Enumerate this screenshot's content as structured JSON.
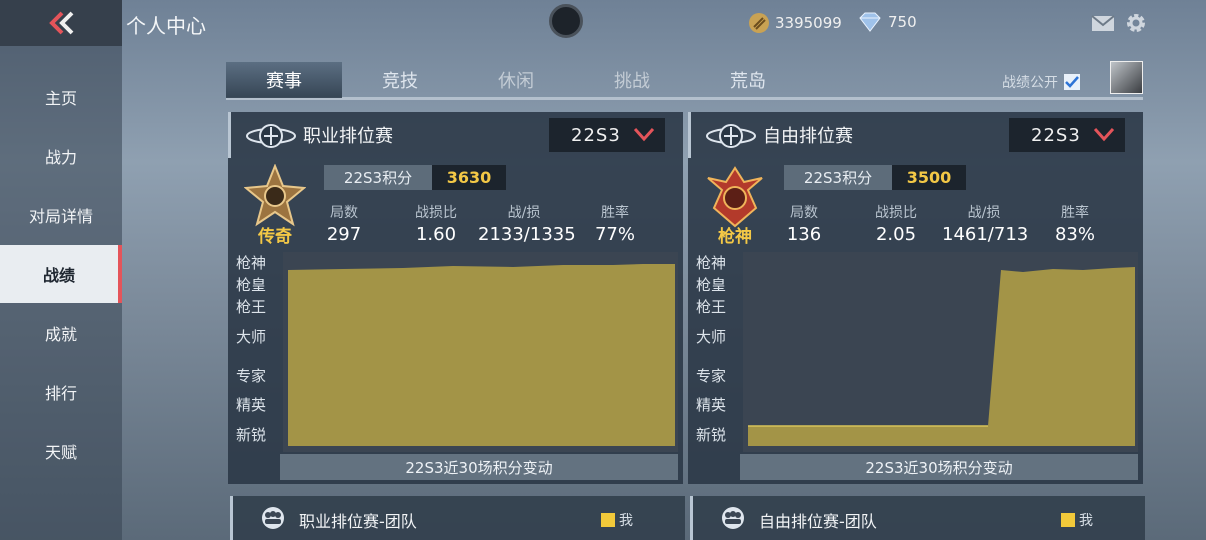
{
  "header": {
    "title": "个人中心",
    "coins": "3395099",
    "diamonds": "750"
  },
  "sidebar": {
    "items": [
      {
        "label": "主页"
      },
      {
        "label": "战力"
      },
      {
        "label": "对局详情"
      },
      {
        "label": "战绩",
        "active": true
      },
      {
        "label": "成就"
      },
      {
        "label": "排行"
      },
      {
        "label": "天赋"
      }
    ]
  },
  "tabs": [
    {
      "label": "赛事",
      "active": true
    },
    {
      "label": "竞技"
    },
    {
      "label": "休闲"
    },
    {
      "label": "挑战"
    },
    {
      "label": "荒岛"
    }
  ],
  "public_toggle": {
    "label": "战绩公开",
    "checked": true
  },
  "panels": [
    {
      "title": "职业排位赛",
      "season": "22S3",
      "rank_name": "传奇",
      "points_label": "22S3积分",
      "points": "3630",
      "stats": [
        {
          "label": "局数",
          "value": "297"
        },
        {
          "label": "战损比",
          "value": "1.60"
        },
        {
          "label": "战/损",
          "value": "2133/1335"
        },
        {
          "label": "胜率",
          "value": "77%"
        }
      ],
      "y_labels": [
        "枪神",
        "枪皇",
        "枪王",
        "大师",
        "专家",
        "精英",
        "新锐"
      ],
      "caption": "22S3近30场积分变动"
    },
    {
      "title": "自由排位赛",
      "season": "22S3",
      "rank_name": "枪神",
      "points_label": "22S3积分",
      "points": "3500",
      "stats": [
        {
          "label": "局数",
          "value": "136"
        },
        {
          "label": "战损比",
          "value": "2.05"
        },
        {
          "label": "战/损",
          "value": "1461/713"
        },
        {
          "label": "胜率",
          "value": "83%"
        }
      ],
      "y_labels": [
        "枪神",
        "枪皇",
        "枪王",
        "大师",
        "专家",
        "精英",
        "新锐"
      ],
      "caption": "22S3近30场积分变动"
    }
  ],
  "team_panels": [
    {
      "title": "职业排位赛-团队",
      "legend": "我"
    },
    {
      "title": "自由排位赛-团队",
      "legend": "我"
    }
  ],
  "colors": {
    "accent_red": "#e4545a",
    "gold": "#f3c846",
    "chart_fill": "#a39447"
  }
}
